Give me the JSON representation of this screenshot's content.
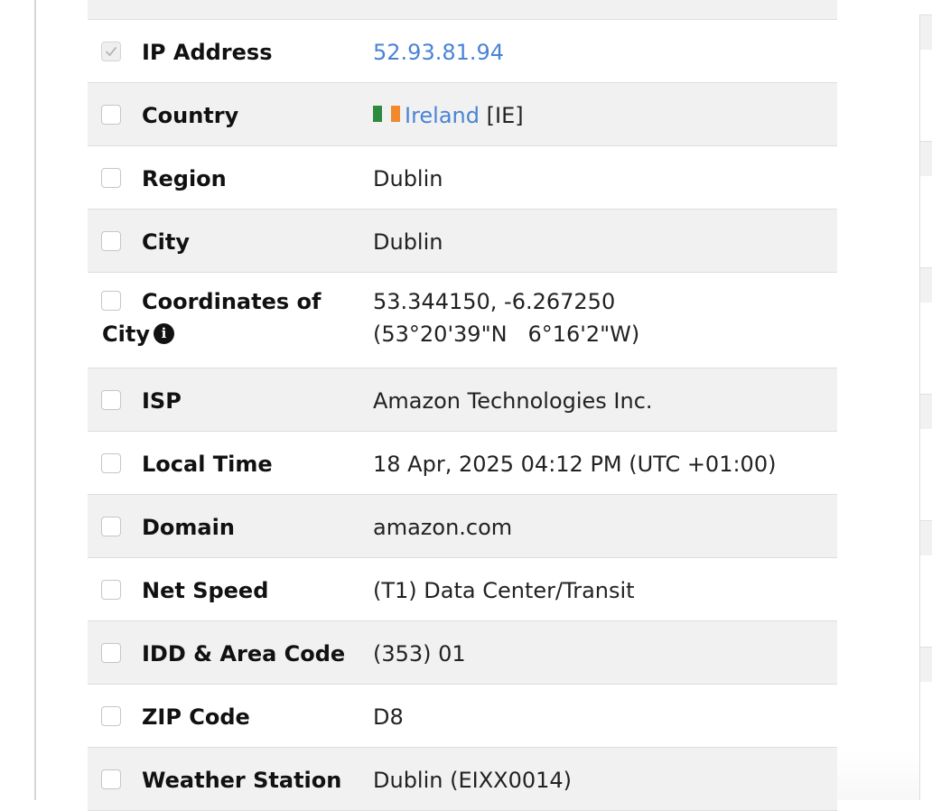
{
  "rows": [
    {
      "label": "IP Address",
      "value": "52.93.81.94",
      "checked": true
    },
    {
      "label": "Country",
      "value_link": "Ireland",
      "value_suffix": "[IE]",
      "flag_colors": [
        "#2e8b3e",
        "#f08a2e"
      ],
      "checked": false
    },
    {
      "label": "Region",
      "value": "Dublin",
      "checked": false
    },
    {
      "label": "City",
      "value": "Dublin",
      "checked": false
    },
    {
      "label_line1": "Coordinates of",
      "label_line2": "City",
      "info_icon": "info-icon",
      "value_line1": "53.344150, -6.267250",
      "value_line2": "(53°20'39\"N   6°16'2\"W)",
      "checked": false
    },
    {
      "label": "ISP",
      "value": "Amazon Technologies Inc.",
      "checked": false
    },
    {
      "label": "Local Time",
      "value": "18 Apr, 2025 04:12 PM (UTC +01:00)",
      "checked": false
    },
    {
      "label": "Domain",
      "value": "amazon.com",
      "checked": false
    },
    {
      "label": "Net Speed",
      "value": "(T1) Data Center/Transit",
      "checked": false
    },
    {
      "label": "IDD & Area Code",
      "value": "(353) 01",
      "checked": false
    },
    {
      "label": "ZIP Code",
      "value": "D8",
      "checked": false
    },
    {
      "label": "Weather Station",
      "value": "Dublin (EIXX0014)",
      "checked": false
    }
  ],
  "colors": {
    "link": "#4a84d4",
    "row_alt": "#f1f1f1",
    "text": "#222222"
  }
}
